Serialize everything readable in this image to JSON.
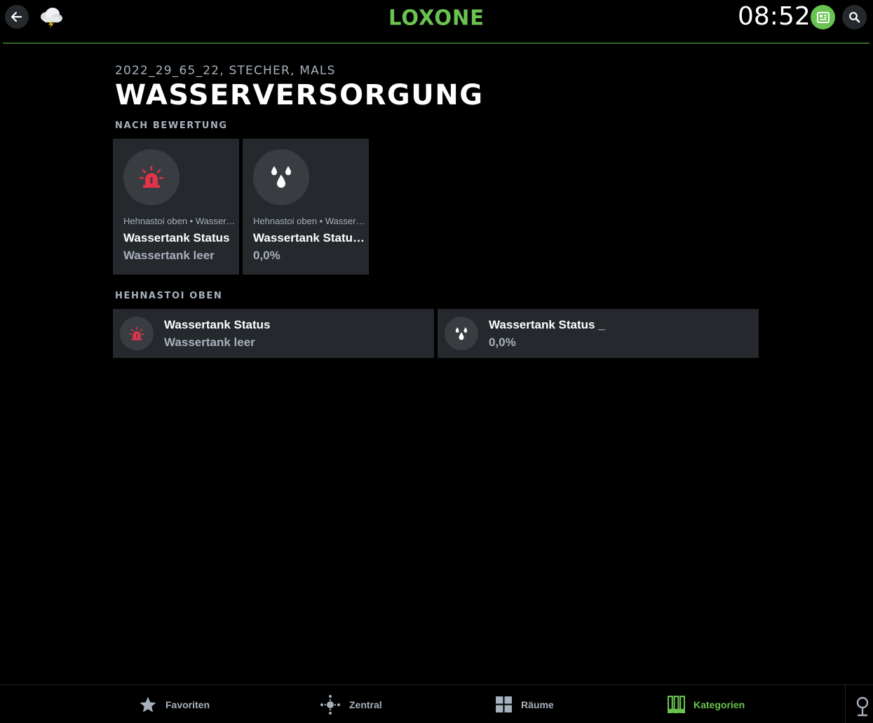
{
  "header": {
    "logo": "LOXONE",
    "clock": "08:52",
    "back_icon": "arrow-left-icon",
    "weather_icon": "cloud-thunder-icon",
    "news_icon": "newspaper-icon",
    "search_icon": "search-icon"
  },
  "breadcrumb": "2022_29_65_22, STECHER, MALS",
  "title": "WASSERVERSORGUNG",
  "sections": {
    "rating": "NACH BEWERTUNG",
    "room": "HEHNASTOI OBEN"
  },
  "tiles": [
    {
      "icon": "siren-icon",
      "subtitle": "Hehnastoi oben • Wasserversorgung",
      "name": "Wassertank Status",
      "state": "Wassertank leer"
    },
    {
      "icon": "water-drops-icon",
      "subtitle": "Hehnastoi oben • Wasserversorgung",
      "name": "Wassertank Status _",
      "state": "0,0%"
    }
  ],
  "rows": [
    {
      "icon": "siren-icon",
      "name": "Wassertank Status",
      "state": "Wassertank leer"
    },
    {
      "icon": "water-drops-icon",
      "name": "Wassertank Status _",
      "state": "0,0%"
    }
  ],
  "nav": {
    "favorites": "Favoriten",
    "central": "Zentral",
    "rooms": "Räume",
    "categories": "Kategorien",
    "active": "Kategorien"
  },
  "colors": {
    "accent": "#69c350",
    "alarm": "#e2334b",
    "tile_bg": "#25282c",
    "muted_text": "#a7b1bd"
  }
}
